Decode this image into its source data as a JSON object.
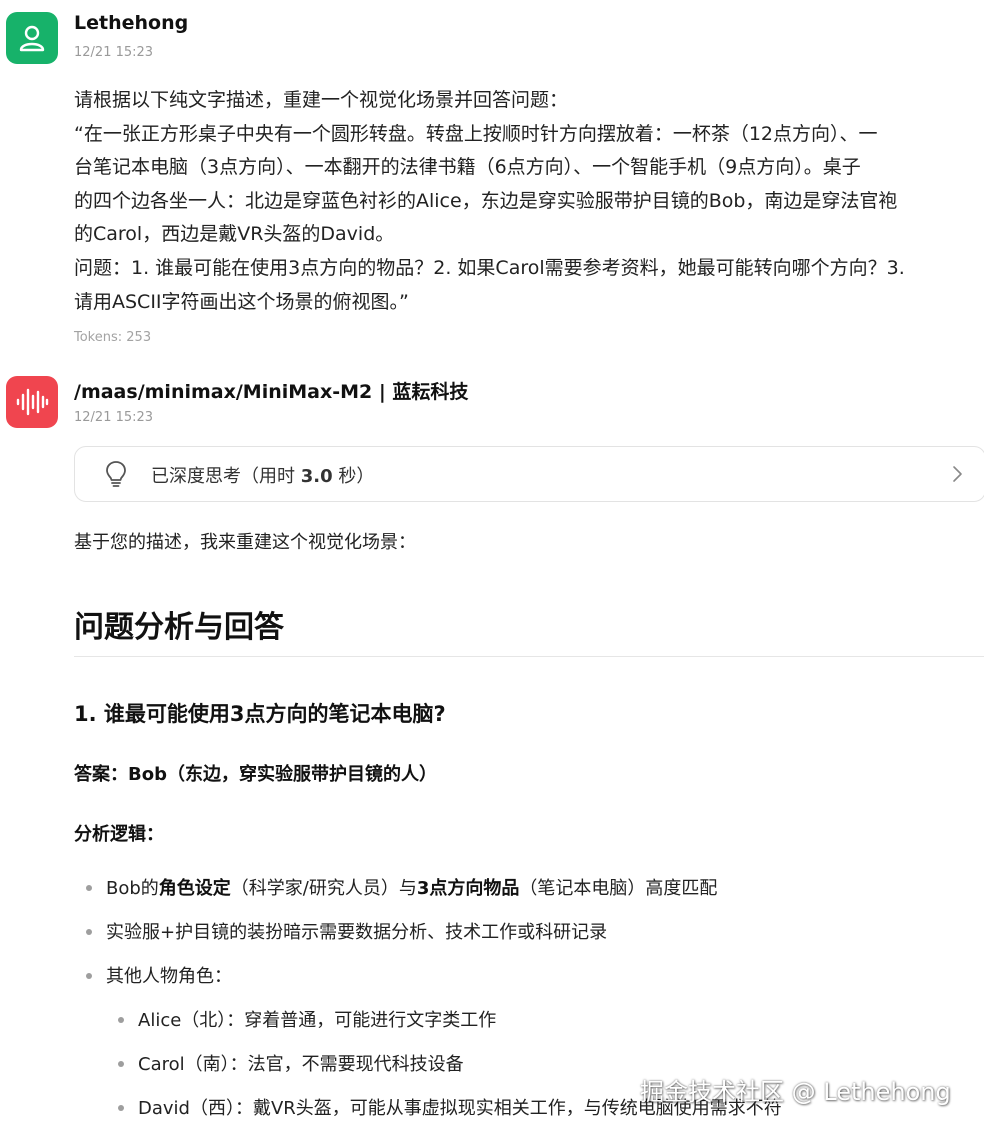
{
  "user_message": {
    "sender": "Lethehong",
    "time": "12/21 15:23",
    "lines": [
      "请根据以下纯文字描述，重建一个视觉化场景并回答问题：",
      "“在一张正方形桌子中央有一个圆形转盘。转盘上按顺时针方向摆放着：一杯茶（12点方向）、一",
      "台笔记本电脑（3点方向）、一本翻开的法律书籍（6点方向）、一个智能手机（9点方向）。桌子",
      "的四个边各坐一人：北边是穿蓝色衬衫的Alice，东边是穿实验服带护目镜的Bob，南边是穿法官袍",
      "的Carol，西边是戴VR头盔的David。",
      "问题：1. 谁最可能在使用3点方向的物品？2. 如果Carol需要参考资料，她最可能转向哪个方向？3.",
      "请用ASCII字符画出这个场景的俯视图。”"
    ],
    "tokens": "Tokens: 253"
  },
  "bot_message": {
    "sender": "/maas/minimax/MiniMax-M2 | 蓝耘科技",
    "time": "12/21 15:23",
    "thinking": {
      "prefix": "已深度思考（用时 ",
      "value": "3.0",
      "suffix": " 秒）"
    },
    "intro": "基于您的描述，我来重建这个视觉化场景：",
    "heading": "问题分析与回答",
    "q1_heading": "1. 谁最可能使用3点方向的笔记本电脑?",
    "answer": "答案：Bob（东边，穿实验服带护目镜的人）",
    "logic_label": "分析逻辑：",
    "bullets": {
      "b1": {
        "t1": "Bob的",
        "t2": "角色设定",
        "t3": "（科学家/研究人员）与",
        "t4": "3点方向物品",
        "t5": "（笔记本电脑）高度匹配"
      },
      "b2": "实验服+护目镜的装扮暗示需要数据分析、技术工作或科研记录",
      "b3": "其他人物角色：",
      "sub1": "Alice（北）：穿着普通，可能进行文字类工作",
      "sub2": "Carol（南）：法官，不需要现代科技设备",
      "sub3": "David（西）：戴VR头盔，可能从事虚拟现实相关工作，与传统电脑使用需求不符"
    }
  },
  "watermark": "掘金技术社区 @ Lethehong",
  "colors": {
    "user_avatar": "#17b26a",
    "bot_avatar": "#f0454f"
  },
  "icons": [
    "user-avatar-icon",
    "soundwave-avatar-icon",
    "lightbulb-icon",
    "chevron-right-icon"
  ]
}
